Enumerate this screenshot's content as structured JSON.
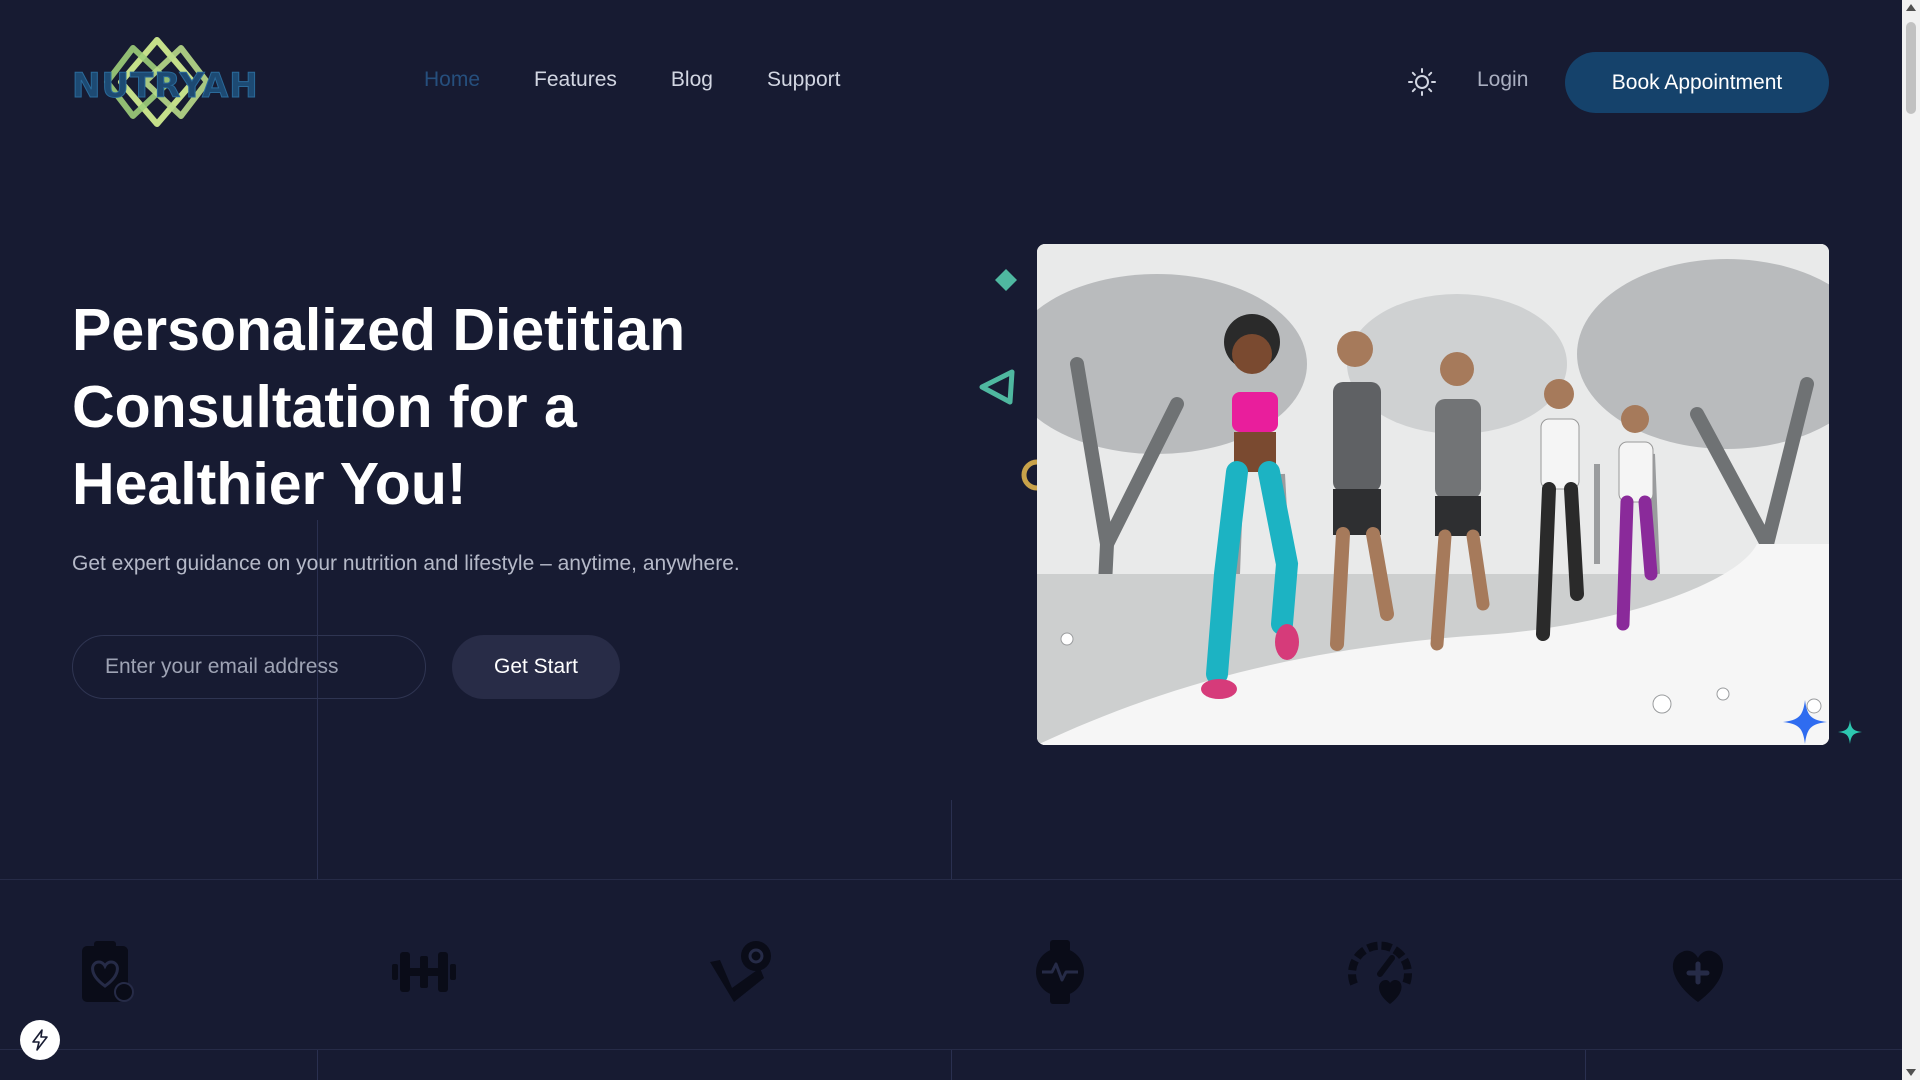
{
  "brand": {
    "logo_text": "NUTRYAH"
  },
  "nav": {
    "items": [
      {
        "label": "Home",
        "active": true
      },
      {
        "label": "Features",
        "active": false
      },
      {
        "label": "Blog",
        "active": false
      },
      {
        "label": "Support",
        "active": false
      }
    ],
    "theme_icon": "sun-icon",
    "login_label": "Login",
    "cta_label": "Book Appointment"
  },
  "hero": {
    "title_lines": [
      "Personalized Dietitian",
      "Consultation for a",
      "Healthier You!"
    ],
    "subtitle": "Get expert guidance on your nutrition and lifestyle – anytime, anywhere.",
    "email_placeholder": "Enter your email address",
    "cta_label": "Get Start",
    "image_icon": "group-jogging-illustration"
  },
  "features": {
    "icons": [
      "clipboard-heart-icon",
      "dumbbell-icon",
      "scale-pin-icon",
      "smartwatch-pulse-icon",
      "gauge-heart-icon",
      "heart-plus-icon"
    ]
  },
  "colors": {
    "background": "#171b32",
    "primary": "#15426b",
    "nav_active": "#264f7d",
    "text": "#ffffff",
    "muted_text": "#b5b9c8",
    "accent_teal": "#4fb8a0",
    "accent_blue": "#2f6cf0",
    "accent_gold": "#c8a24a"
  }
}
